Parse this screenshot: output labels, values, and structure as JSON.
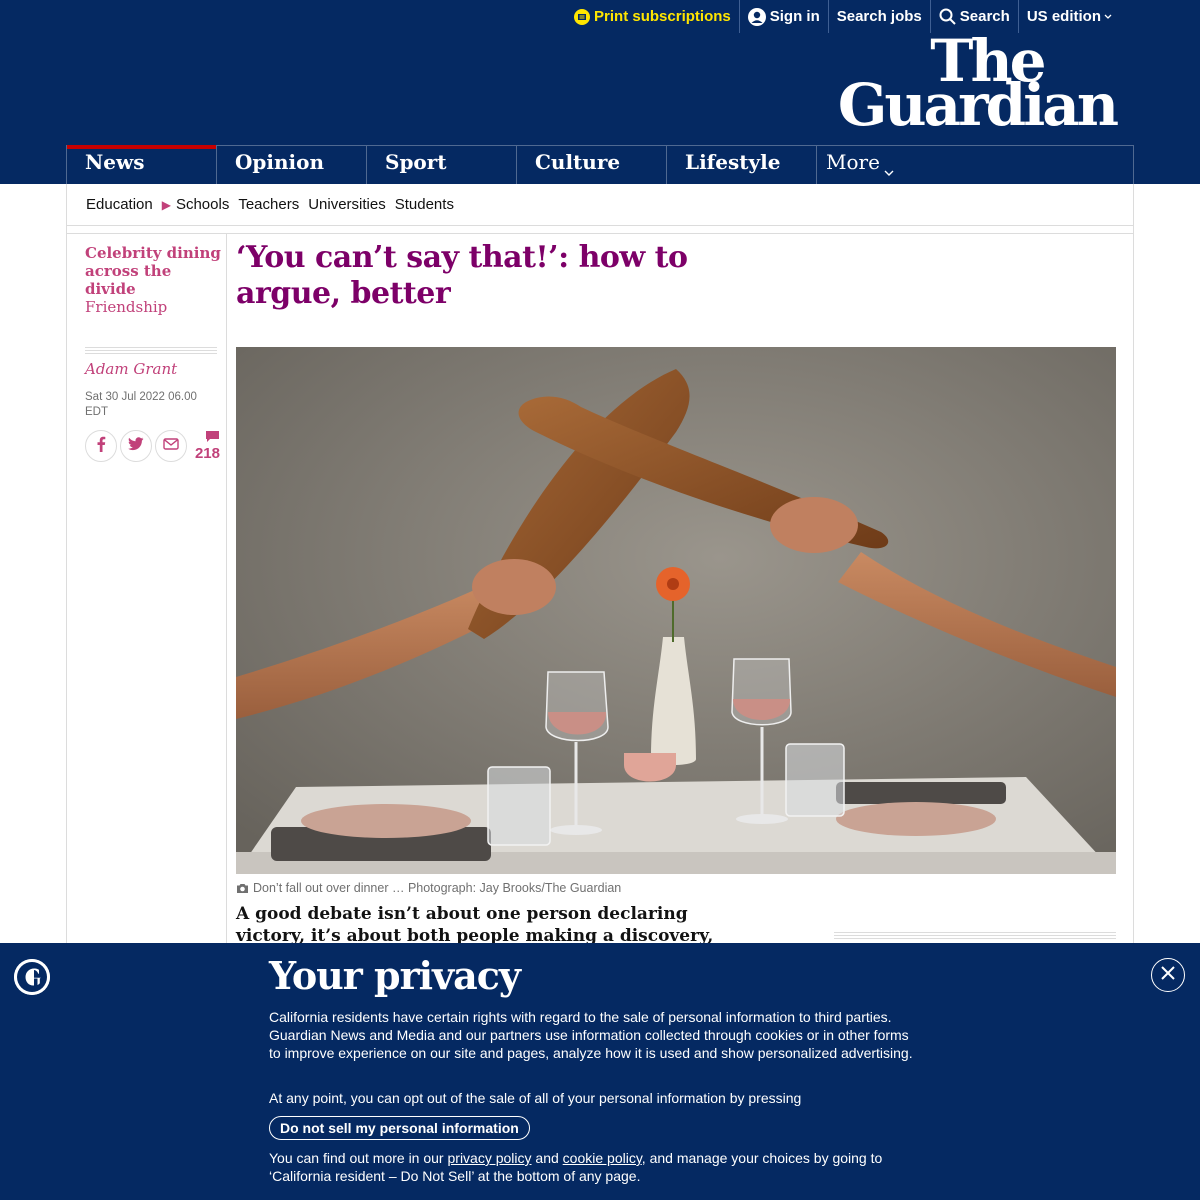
{
  "topbar": {
    "print_subscriptions": "Print subscriptions",
    "sign_in": "Sign in",
    "search_jobs": "Search jobs",
    "search": "Search",
    "edition": "US edition"
  },
  "masthead": {
    "logo_line1": "The",
    "logo_line2": "Guardian"
  },
  "pillars": [
    {
      "label": "News"
    },
    {
      "label": "Opinion"
    },
    {
      "label": "Sport"
    },
    {
      "label": "Culture"
    },
    {
      "label": "Lifestyle"
    },
    {
      "label": "More"
    }
  ],
  "subnav": {
    "parent": "Education",
    "items": [
      "Schools",
      "Teachers",
      "Universities",
      "Students"
    ]
  },
  "article": {
    "series_line1": "Celebrity dining",
    "series_line2": "across the divide",
    "series_sub": "Friendship",
    "headline": "‘You can’t say that!’: how to argue, better",
    "byline": "Adam Grant",
    "dateline": "Sat 30 Jul 2022 06.00 EDT",
    "comment_count": "218",
    "caption": "Don’t fall out over dinner … Photograph: Jay Brooks/The Guardian",
    "standfirst": "A good debate isn’t about one person declaring victory, it’s about both people making a discovery, says"
  },
  "privacy": {
    "title": "Your privacy",
    "paragraph1": "California residents have certain rights with regard to the sale of personal information to third parties. Guardian News and Media and our partners use information collected through cookies or in other forms to improve experience on our site and pages, analyze how it is used and show personalized advertising.",
    "paragraph2": "At any point, you can opt out of the sale of all of your personal information by pressing",
    "optout_button": "Do not sell my personal information",
    "p3_before": "You can find out more in our ",
    "privacy_policy_link": "privacy policy",
    "p3_and": " and ",
    "cookie_policy_link": "cookie policy",
    "p3_after": ", and manage your choices by going to ‘California resident – Do Not Sell’ at the bottom of any page."
  },
  "colors": {
    "brand_blue": "#052962",
    "accent_yellow": "#ffe500",
    "lifestyle_pink": "#c1417a",
    "headline_purple": "#7d0068",
    "news_red": "#c70000"
  }
}
